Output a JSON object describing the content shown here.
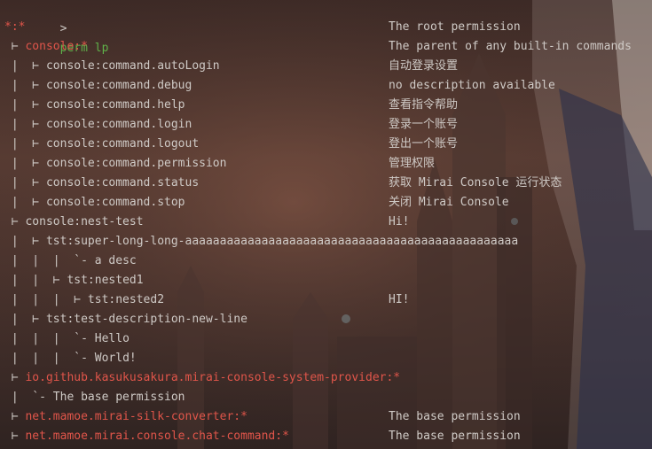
{
  "prompt": {
    "symbol": ">",
    "command": "perm lp"
  },
  "rows": [
    {
      "tree": "",
      "perm": "*:*",
      "perm_color": "red",
      "desc": "The root permission"
    },
    {
      "tree": " ⊢ ",
      "perm": "console:*",
      "perm_color": "red",
      "desc": "The parent of any built-in commands"
    },
    {
      "tree": " |  ⊢ ",
      "perm": "console:command.autoLogin",
      "perm_color": "plain",
      "desc": "自动登录设置"
    },
    {
      "tree": " |  ⊢ ",
      "perm": "console:command.debug",
      "perm_color": "plain",
      "desc": "no description available"
    },
    {
      "tree": " |  ⊢ ",
      "perm": "console:command.help",
      "perm_color": "plain",
      "desc": "查看指令帮助"
    },
    {
      "tree": " |  ⊢ ",
      "perm": "console:command.login",
      "perm_color": "plain",
      "desc": "登录一个账号"
    },
    {
      "tree": " |  ⊢ ",
      "perm": "console:command.logout",
      "perm_color": "plain",
      "desc": "登出一个账号"
    },
    {
      "tree": " |  ⊢ ",
      "perm": "console:command.permission",
      "perm_color": "plain",
      "desc": "管理权限"
    },
    {
      "tree": " |  ⊢ ",
      "perm": "console:command.status",
      "perm_color": "plain",
      "desc": "获取 Mirai Console 运行状态"
    },
    {
      "tree": " |  ⊢ ",
      "perm": "console:command.stop",
      "perm_color": "plain",
      "desc": "关闭 Mirai Console"
    },
    {
      "tree": " ⊢ ",
      "perm": "console:nest-test",
      "perm_color": "plain",
      "desc": "Hi!"
    },
    {
      "tree": " |  ⊢ ",
      "perm": "tst:super-long-long-aaaaaaaaaaaaaaaaaaaaaaaaaaaaaaaaaaaaaaaaaaaaaaaa",
      "perm_color": "plain",
      "desc": ""
    },
    {
      "tree": " |  |  |  ",
      "perm": "`- a desc",
      "perm_color": "plain",
      "desc": ""
    },
    {
      "tree": " |  |  ⊢ ",
      "perm": "tst:nested1",
      "perm_color": "plain",
      "desc": ""
    },
    {
      "tree": " |  |  |  ⊢ ",
      "perm": "tst:nested2",
      "perm_color": "plain",
      "desc": "HI!"
    },
    {
      "tree": " |  ⊢ ",
      "perm": "tst:test-description-new-line",
      "perm_color": "plain",
      "desc": ""
    },
    {
      "tree": " |  |  |  ",
      "perm": "`- Hello",
      "perm_color": "plain",
      "desc": ""
    },
    {
      "tree": " |  |  |  ",
      "perm": "`- World!",
      "perm_color": "plain",
      "desc": ""
    },
    {
      "tree": " ⊢ ",
      "perm": "io.github.kasukusakura.mirai-console-system-provider:*",
      "perm_color": "red",
      "desc": ""
    },
    {
      "tree": " |  ",
      "perm": "`- The base permission",
      "perm_color": "plain",
      "desc": ""
    },
    {
      "tree": " ⊢ ",
      "perm": "net.mamoe.mirai-silk-converter:*",
      "perm_color": "red",
      "desc": "The base permission"
    },
    {
      "tree": " ⊢ ",
      "perm": "net.mamoe.mirai.console.chat-command:*",
      "perm_color": "red",
      "desc": "The base permission"
    }
  ],
  "colors": {
    "red": "#e0554a",
    "plain": "#cfcac6",
    "green": "#5fb049"
  }
}
